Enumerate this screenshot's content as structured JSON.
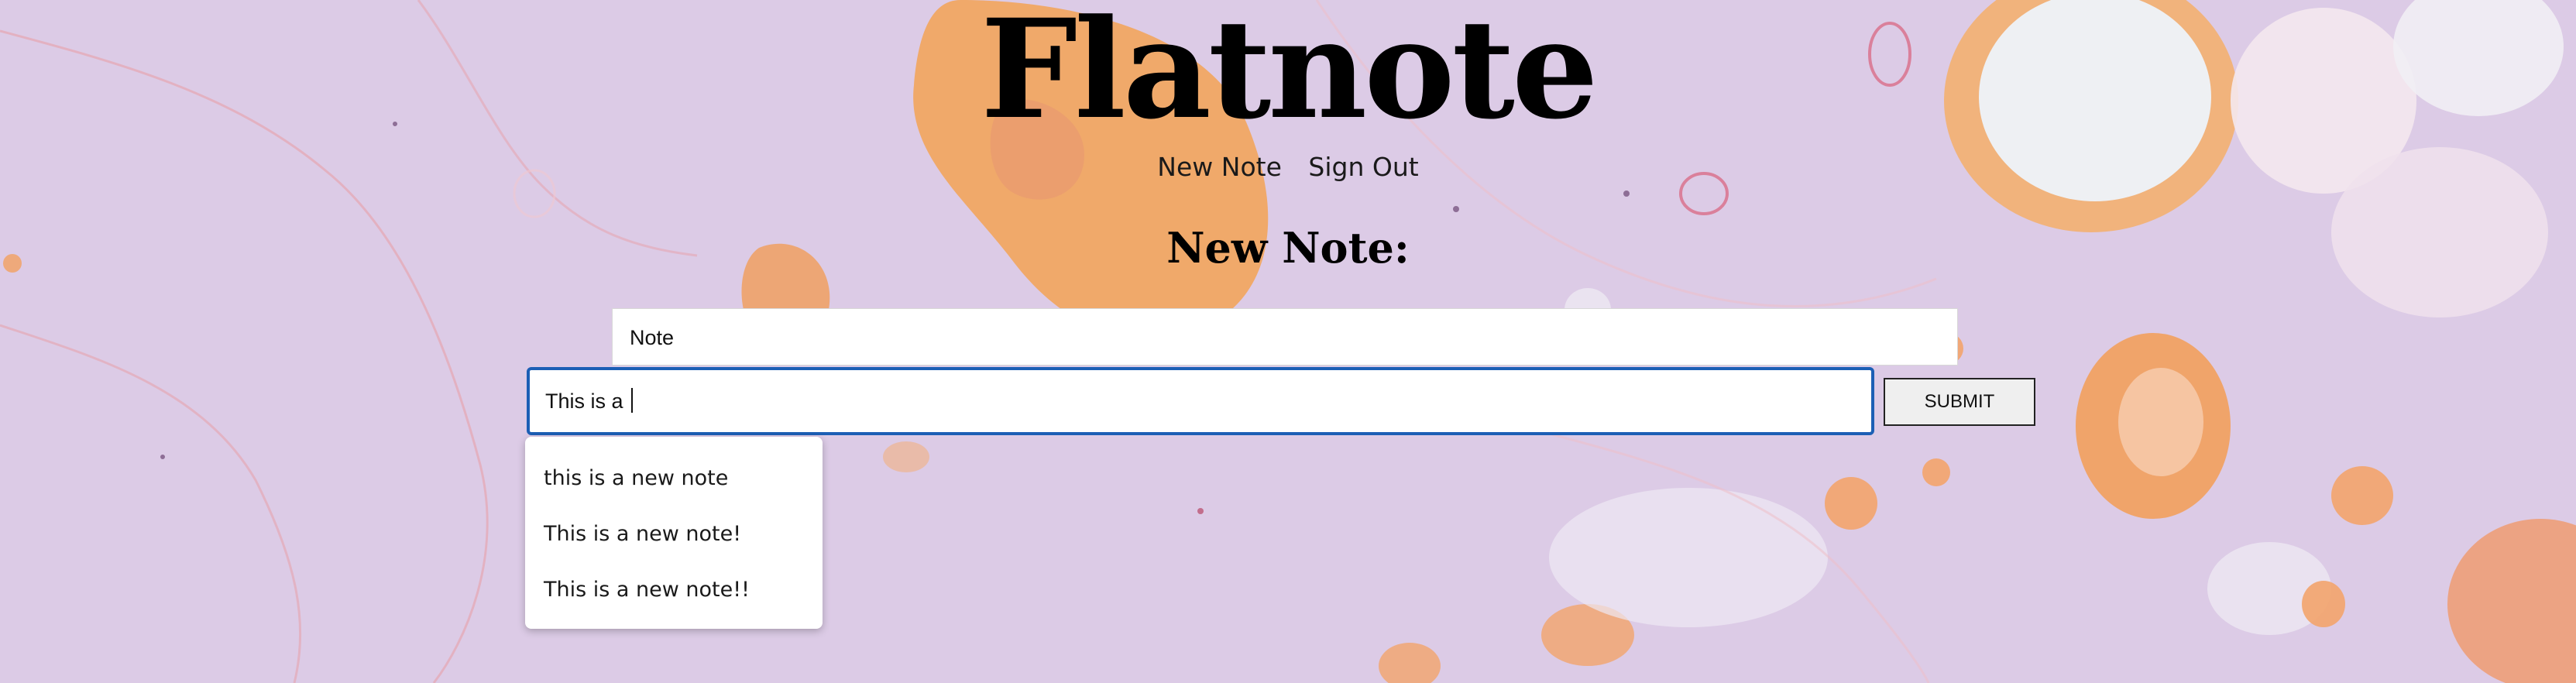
{
  "header": {
    "title": "Flatnote"
  },
  "nav": {
    "items": [
      {
        "label": "New Note"
      },
      {
        "label": "Sign Out"
      }
    ]
  },
  "page": {
    "subtitle": "New Note:"
  },
  "form": {
    "title_value": "Note",
    "note_value": "This is a ",
    "submit_label": "SUBMIT"
  },
  "autocomplete": {
    "items": [
      {
        "label": "this is a new note"
      },
      {
        "label": "This is a new note!"
      },
      {
        "label": "This is a new note!!"
      }
    ]
  },
  "colors": {
    "focus_border": "#1c5fb5",
    "background": "#dccbe6",
    "accent_orange": "#f0a860"
  }
}
